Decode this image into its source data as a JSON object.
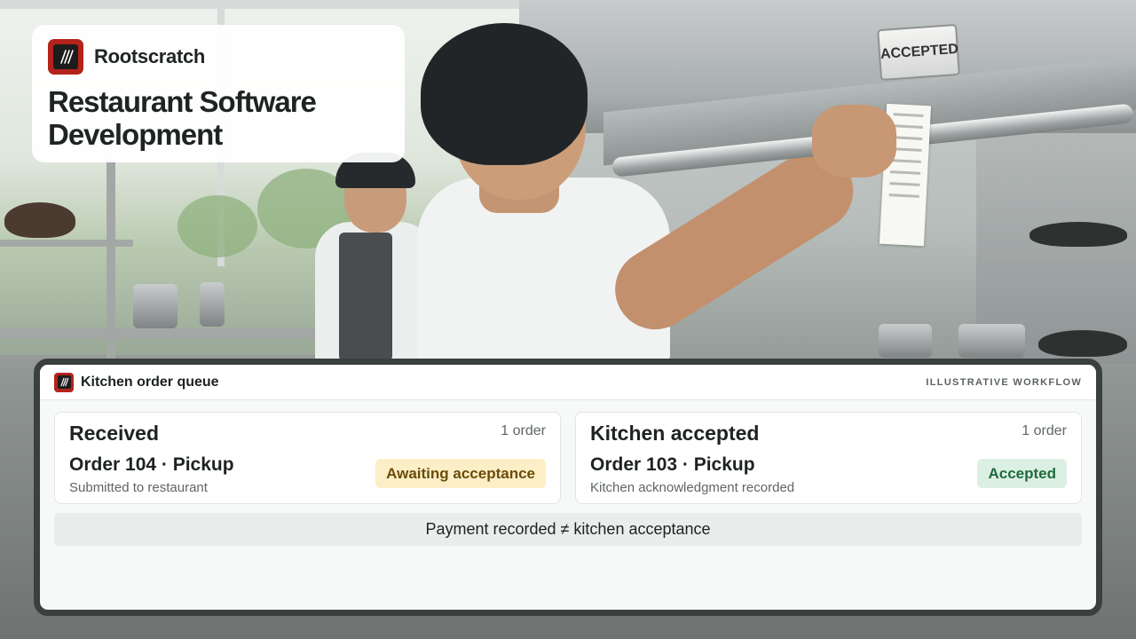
{
  "brand": {
    "name": "Rootscratch",
    "headline_line1": "Restaurant Software",
    "headline_line2": "Development"
  },
  "photo": {
    "sign_text": "ACCEPTED"
  },
  "panel": {
    "title": "Kitchen order queue",
    "tag": "ILLUSTRATIVE WORKFLOW",
    "columns": [
      {
        "title": "Received",
        "count": "1 order",
        "order": "Order 104 · Pickup",
        "detail": "Submitted to restaurant",
        "badge": "Awaiting acceptance",
        "badge_color": "#fcefc7"
      },
      {
        "title": "Kitchen accepted",
        "count": "1 order",
        "order": "Order 103 · Pickup",
        "detail": "Kitchen acknowledgment recorded",
        "badge": "Accepted",
        "badge_color": "#dcefe3"
      }
    ],
    "note": "Payment recorded ≠ kitchen acceptance"
  },
  "colors": {
    "brand_red": "#b3231b",
    "frame": "#3a3f3f"
  }
}
